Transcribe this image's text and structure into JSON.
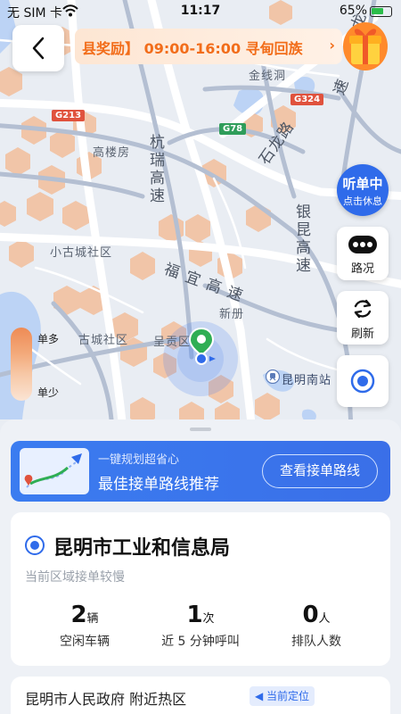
{
  "status_bar": {
    "carrier": "无 SIM 卡",
    "time": "11:17",
    "battery_text": "65%",
    "battery_level": 0.65
  },
  "banner": {
    "text": "县奖励】 09:00-16:00 寻甸回族",
    "chevron": "›"
  },
  "map": {
    "labels": {
      "jinxian": "金线洞",
      "gaolou": "高楼房",
      "hangrui": "杭瑞高速",
      "shilong": "石龙路",
      "yinkun": "银昆高速",
      "fuyi": "福宜高速",
      "xiaogucheng": "小古城社区",
      "xince": "新册",
      "gucheng": "古城社区",
      "chenggong": "呈贡区",
      "station": "昆明南站",
      "su": "速",
      "lu": "龙"
    },
    "shields": {
      "g213": "G213",
      "g78": "G78",
      "g324": "G324"
    }
  },
  "controls": {
    "listen_title": "听单中",
    "listen_sub": "点击休息",
    "traffic_label": "路况",
    "refresh_label": "刷新"
  },
  "legend": {
    "high": "单多",
    "low": "单少"
  },
  "route_card": {
    "subtitle": "一键规划超省心",
    "title": "最佳接单路线推荐",
    "button": "查看接单路线"
  },
  "area_card": {
    "title": "昆明市工业和信息局",
    "desc": "当前区域接单较慢",
    "stats": [
      {
        "num": "2",
        "unit": "辆",
        "caption": "空闲车辆"
      },
      {
        "num": "1",
        "unit": "次",
        "caption": "近 5 分钟呼叫"
      },
      {
        "num": "0",
        "unit": "人",
        "caption": "排队人数"
      }
    ]
  },
  "hotspot": {
    "title": "昆明市人民政府 附近热区",
    "badge": "当前定位"
  },
  "colors": {
    "accent": "#2f6bea",
    "heat": "#f3b78f",
    "promo": "#f26d1a"
  }
}
